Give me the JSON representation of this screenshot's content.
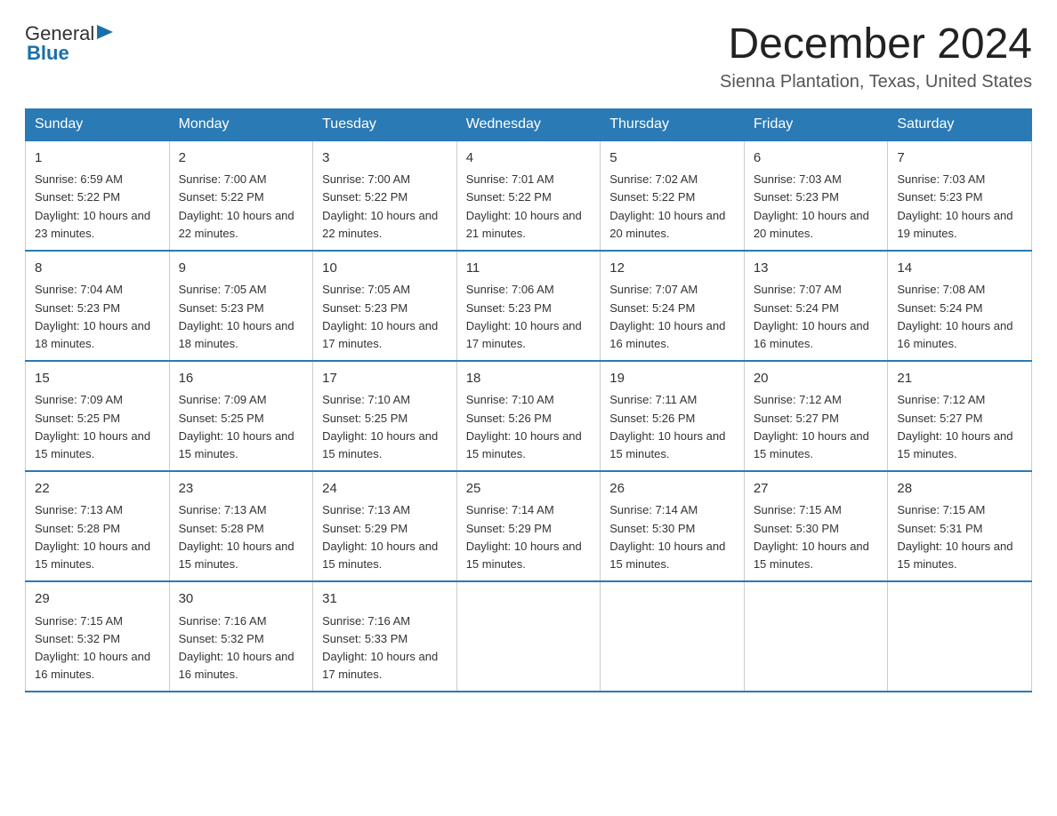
{
  "header": {
    "logo_general": "General",
    "logo_blue": "Blue",
    "month_title": "December 2024",
    "subtitle": "Sienna Plantation, Texas, United States"
  },
  "days_of_week": [
    "Sunday",
    "Monday",
    "Tuesday",
    "Wednesday",
    "Thursday",
    "Friday",
    "Saturday"
  ],
  "weeks": [
    [
      {
        "day": "1",
        "sunrise": "6:59 AM",
        "sunset": "5:22 PM",
        "daylight": "10 hours and 23 minutes."
      },
      {
        "day": "2",
        "sunrise": "7:00 AM",
        "sunset": "5:22 PM",
        "daylight": "10 hours and 22 minutes."
      },
      {
        "day": "3",
        "sunrise": "7:00 AM",
        "sunset": "5:22 PM",
        "daylight": "10 hours and 22 minutes."
      },
      {
        "day": "4",
        "sunrise": "7:01 AM",
        "sunset": "5:22 PM",
        "daylight": "10 hours and 21 minutes."
      },
      {
        "day": "5",
        "sunrise": "7:02 AM",
        "sunset": "5:22 PM",
        "daylight": "10 hours and 20 minutes."
      },
      {
        "day": "6",
        "sunrise": "7:03 AM",
        "sunset": "5:23 PM",
        "daylight": "10 hours and 20 minutes."
      },
      {
        "day": "7",
        "sunrise": "7:03 AM",
        "sunset": "5:23 PM",
        "daylight": "10 hours and 19 minutes."
      }
    ],
    [
      {
        "day": "8",
        "sunrise": "7:04 AM",
        "sunset": "5:23 PM",
        "daylight": "10 hours and 18 minutes."
      },
      {
        "day": "9",
        "sunrise": "7:05 AM",
        "sunset": "5:23 PM",
        "daylight": "10 hours and 18 minutes."
      },
      {
        "day": "10",
        "sunrise": "7:05 AM",
        "sunset": "5:23 PM",
        "daylight": "10 hours and 17 minutes."
      },
      {
        "day": "11",
        "sunrise": "7:06 AM",
        "sunset": "5:23 PM",
        "daylight": "10 hours and 17 minutes."
      },
      {
        "day": "12",
        "sunrise": "7:07 AM",
        "sunset": "5:24 PM",
        "daylight": "10 hours and 16 minutes."
      },
      {
        "day": "13",
        "sunrise": "7:07 AM",
        "sunset": "5:24 PM",
        "daylight": "10 hours and 16 minutes."
      },
      {
        "day": "14",
        "sunrise": "7:08 AM",
        "sunset": "5:24 PM",
        "daylight": "10 hours and 16 minutes."
      }
    ],
    [
      {
        "day": "15",
        "sunrise": "7:09 AM",
        "sunset": "5:25 PM",
        "daylight": "10 hours and 15 minutes."
      },
      {
        "day": "16",
        "sunrise": "7:09 AM",
        "sunset": "5:25 PM",
        "daylight": "10 hours and 15 minutes."
      },
      {
        "day": "17",
        "sunrise": "7:10 AM",
        "sunset": "5:25 PM",
        "daylight": "10 hours and 15 minutes."
      },
      {
        "day": "18",
        "sunrise": "7:10 AM",
        "sunset": "5:26 PM",
        "daylight": "10 hours and 15 minutes."
      },
      {
        "day": "19",
        "sunrise": "7:11 AM",
        "sunset": "5:26 PM",
        "daylight": "10 hours and 15 minutes."
      },
      {
        "day": "20",
        "sunrise": "7:12 AM",
        "sunset": "5:27 PM",
        "daylight": "10 hours and 15 minutes."
      },
      {
        "day": "21",
        "sunrise": "7:12 AM",
        "sunset": "5:27 PM",
        "daylight": "10 hours and 15 minutes."
      }
    ],
    [
      {
        "day": "22",
        "sunrise": "7:13 AM",
        "sunset": "5:28 PM",
        "daylight": "10 hours and 15 minutes."
      },
      {
        "day": "23",
        "sunrise": "7:13 AM",
        "sunset": "5:28 PM",
        "daylight": "10 hours and 15 minutes."
      },
      {
        "day": "24",
        "sunrise": "7:13 AM",
        "sunset": "5:29 PM",
        "daylight": "10 hours and 15 minutes."
      },
      {
        "day": "25",
        "sunrise": "7:14 AM",
        "sunset": "5:29 PM",
        "daylight": "10 hours and 15 minutes."
      },
      {
        "day": "26",
        "sunrise": "7:14 AM",
        "sunset": "5:30 PM",
        "daylight": "10 hours and 15 minutes."
      },
      {
        "day": "27",
        "sunrise": "7:15 AM",
        "sunset": "5:30 PM",
        "daylight": "10 hours and 15 minutes."
      },
      {
        "day": "28",
        "sunrise": "7:15 AM",
        "sunset": "5:31 PM",
        "daylight": "10 hours and 15 minutes."
      }
    ],
    [
      {
        "day": "29",
        "sunrise": "7:15 AM",
        "sunset": "5:32 PM",
        "daylight": "10 hours and 16 minutes."
      },
      {
        "day": "30",
        "sunrise": "7:16 AM",
        "sunset": "5:32 PM",
        "daylight": "10 hours and 16 minutes."
      },
      {
        "day": "31",
        "sunrise": "7:16 AM",
        "sunset": "5:33 PM",
        "daylight": "10 hours and 17 minutes."
      },
      null,
      null,
      null,
      null
    ]
  ],
  "colors": {
    "header_bg": "#2a7ab5",
    "accent": "#1a6faa"
  }
}
